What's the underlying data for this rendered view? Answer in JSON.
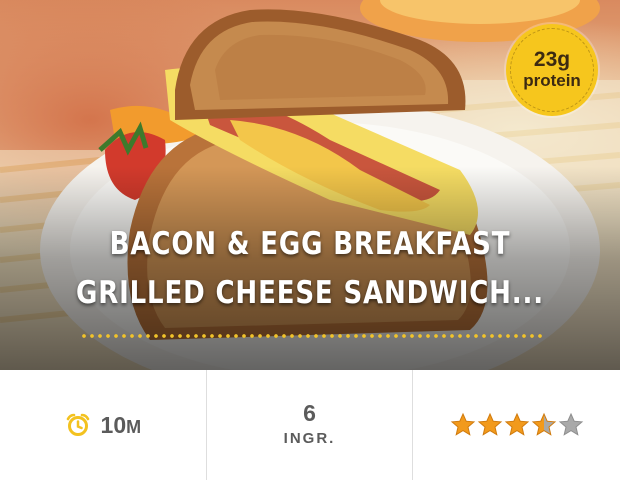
{
  "badge": {
    "line1": "23g",
    "line2": "protein"
  },
  "recipe": {
    "title_line1": "BACON & EGG BREAKFAST",
    "title_line2": "GRILLED CHEESE SANDWICH..."
  },
  "info": {
    "time_value": "10",
    "time_unit": "M",
    "ingredients_count": "6",
    "ingredients_label": "INGR.",
    "rating": 3.5,
    "rating_max": 5
  },
  "icons": {
    "time": "alarm-clock-icon",
    "rating": "star-icon"
  },
  "colors": {
    "accent_yellow": "#f6c61d",
    "clock_icon": "#f3c21f",
    "star_filled": "#f29a1c",
    "star_empty": "#a9a9a9",
    "text_gray": "#5b5b5b"
  }
}
